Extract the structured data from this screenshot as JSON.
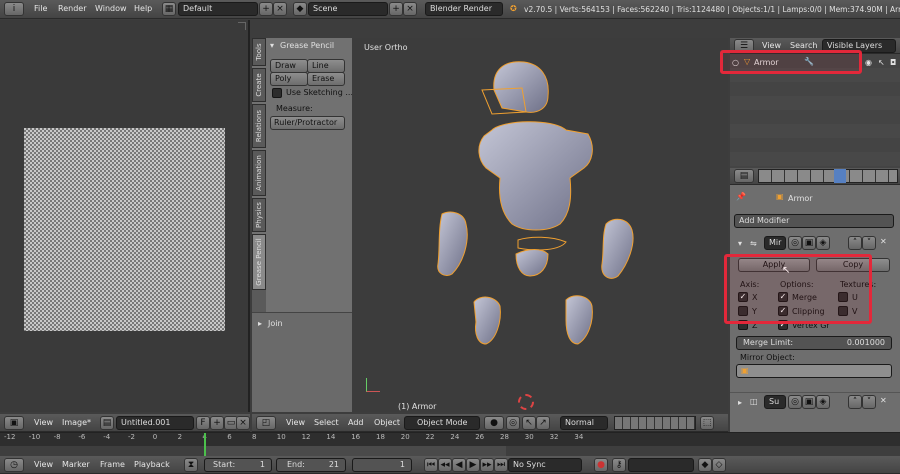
{
  "topbar": {
    "menus": [
      "File",
      "Render",
      "Window",
      "Help"
    ],
    "layout": "Default",
    "scene": "Scene",
    "engine": "Blender Render",
    "stats": "v2.70.5 | Verts:564153 | Faces:562240 | Tris:1124480 | Objects:1/1 | Lamps:0/0 | Mem:374.90M | Armor"
  },
  "image_editor": {
    "menus": [
      "View",
      "Image*"
    ],
    "image_name": "Untitled.001",
    "f_label": "F"
  },
  "tool_shelf": {
    "tabs": [
      "Tools",
      "Create",
      "Relations",
      "Animation",
      "Physics",
      "Grease Pencil"
    ],
    "panel_title": "Grease Pencil",
    "draw": "Draw",
    "line": "Line",
    "poly": "Poly",
    "erase": "Erase",
    "use_sketching": "Use Sketching ...",
    "measure": "Measure:",
    "ruler": "Ruler/Protractor",
    "join": "Join"
  },
  "viewport": {
    "label": "User Ortho",
    "object_label": "(1) Armor",
    "menus": [
      "View",
      "Select",
      "Add",
      "Object"
    ],
    "mode": "Object Mode",
    "orientation": "Normal"
  },
  "outliner": {
    "menus": [
      "View",
      "Search"
    ],
    "display": "Visible Layers",
    "object": "Armor"
  },
  "properties": {
    "object": "Armor",
    "add_modifier": "Add Modifier",
    "mirror_name": "Mir",
    "apply": "Apply",
    "copy": "Copy",
    "axis_label": "Axis:",
    "options_label": "Options:",
    "textures_label": "Textures:",
    "x": "X",
    "y": "Y",
    "z": "Z",
    "merge": "Merge",
    "clipping": "Clipping",
    "vertex_groups": "Vertex Gr",
    "u": "U",
    "v": "V",
    "merge_limit_label": "Merge Limit:",
    "merge_limit_value": "0.001000",
    "mirror_object": "Mirror Object:",
    "subsurf_name": "Su"
  },
  "timeline": {
    "ticks": [
      "-12",
      "-10",
      "-8",
      "-6",
      "-4",
      "-2",
      "0",
      "2",
      "4",
      "6",
      "8",
      "10",
      "12",
      "14",
      "16",
      "18",
      "20",
      "22",
      "24",
      "26",
      "28",
      "30",
      "32",
      "34"
    ],
    "menus": [
      "View",
      "Marker",
      "Frame",
      "Playback"
    ],
    "start_label": "Start:",
    "start": "1",
    "end_label": "End:",
    "end": "21",
    "current": "1",
    "sync": "No Sync"
  },
  "colors": {
    "highlight_red": "#e3283a",
    "active_blue": "#5680c2",
    "selection_orange": "#f0a030"
  }
}
